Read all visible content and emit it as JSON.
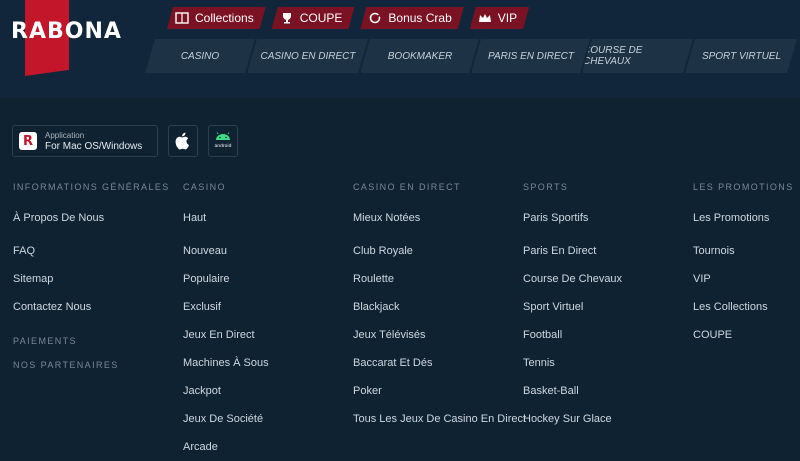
{
  "brand": {
    "name": "RABONA",
    "color": "#c4162b"
  },
  "top_links": [
    {
      "label": "Collections",
      "icon": "book-icon"
    },
    {
      "label": "COUPE",
      "icon": "trophy-icon"
    },
    {
      "label": "Bonus Crab",
      "icon": "crab-claw-icon"
    },
    {
      "label": "VIP",
      "icon": "crown-icon"
    }
  ],
  "nav": [
    "CASINO",
    "CASINO EN DIRECT",
    "BOOKMAKER",
    "PARIS EN DIRECT",
    "COURSE DE CHEVAUX",
    "SPORT VIRTUEL"
  ],
  "apps": {
    "desktop": {
      "line1": "Application",
      "line2": "For Mac OS/Windows"
    },
    "ios_icon": "apple-icon",
    "android_icon": "android-icon"
  },
  "footer": {
    "general": {
      "heading": "INFORMATIONS GÉNÉRALES",
      "items": [
        "À Propos De Nous",
        "FAQ",
        "Sitemap",
        "Contactez Nous"
      ],
      "payments": "PAIEMENTS",
      "partners": "NOS PARTENAIRES"
    },
    "casino": {
      "heading": "CASINO",
      "items": [
        "Haut",
        "Nouveau",
        "Populaire",
        "Exclusif",
        "Jeux En Direct",
        "Machines À Sous",
        "Jackpot",
        "Jeux De Société",
        "Arcade"
      ]
    },
    "live": {
      "heading": "CASINO EN DIRECT",
      "items": [
        "Mieux Notées",
        "Club Royale",
        "Roulette",
        "Blackjack",
        "Jeux Télévisés",
        "Baccarat Et Dés",
        "Poker",
        "Tous Les Jeux De Casino En Direct"
      ]
    },
    "sports": {
      "heading": "SPORTS",
      "items": [
        "Paris Sportifs",
        "Paris En Direct",
        "Course De Chevaux",
        "Sport Virtuel",
        "Football",
        "Tennis",
        "Basket-Ball",
        "Hockey Sur Glace"
      ]
    },
    "promotions": {
      "heading": "LES PROMOTIONS",
      "items": [
        "Les Promotions",
        "Tournois",
        "VIP",
        "Les Collections",
        "COUPE"
      ]
    }
  }
}
